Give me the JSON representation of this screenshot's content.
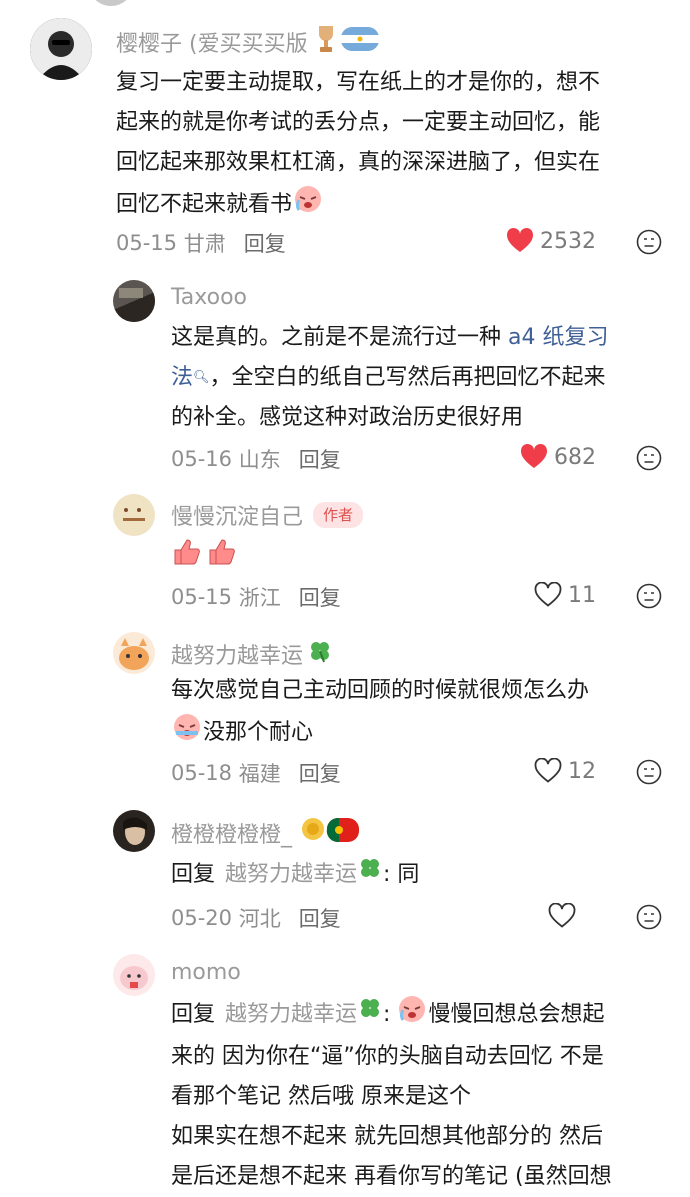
{
  "colors": {
    "like_red": "#ef3e4a",
    "link_blue": "#3f5f97",
    "author_badge_bg": "#fde3e3",
    "author_badge_text": "#e0504f"
  },
  "comments": [
    {
      "name": "樱樱子 (爱买买买版",
      "body": [
        "复习一定要主动提取，写在纸上的才是你的，想不",
        "起来的就是你考试的丢分点，一定要主动回忆，能",
        "回忆起来那效果杠杠滴，真的深深进脑了，但实在",
        "回忆不起来就看书"
      ],
      "date": "05-15",
      "location": "甘肃",
      "reply": "回复",
      "likes": "2532",
      "liked": true
    },
    {
      "name": "Taxooo",
      "body_pre": "这是真的。之前是不是流行过一种 ",
      "link": "a4 纸复习法",
      "body_mid": "，全空白的纸自己写然后再把回忆不起来",
      "body_post": "的补全。感觉这种对政治历史很好用",
      "date": "05-16",
      "location": "山东",
      "reply": "回复",
      "likes": "682",
      "liked": true
    },
    {
      "name": "慢慢沉淀自己",
      "badge": "作者",
      "date": "05-15",
      "location": "浙江",
      "reply": "回复",
      "likes": "11",
      "liked": false
    },
    {
      "name": "越努力越幸运",
      "body": [
        "每次感觉自己主动回顾的时候就很烦怎么办",
        "没那个耐心"
      ],
      "date": "05-18",
      "location": "福建",
      "reply": "回复",
      "likes": "12",
      "liked": false
    },
    {
      "name": "橙橙橙橙橙_",
      "reply_prefix": "回复",
      "reply_to": "越努力越幸运",
      "body_tail": ": 同",
      "date": "05-20",
      "location": "河北",
      "reply": "回复",
      "likes": "",
      "liked": false
    },
    {
      "name": "momo",
      "reply_prefix": "回复",
      "reply_to": "越努力越幸运",
      "colon": ":",
      "body_first": "慢慢回想总会想起",
      "body": [
        "来的 因为你在“逼”你的头脑自动去回忆 不是",
        "看那个笔记 然后哦 原来是这个",
        "如果实在想不起来 就先回想其他部分的 然后",
        "是后还是想不起来 再看你写的笔记 (虽然回想"
      ]
    }
  ]
}
